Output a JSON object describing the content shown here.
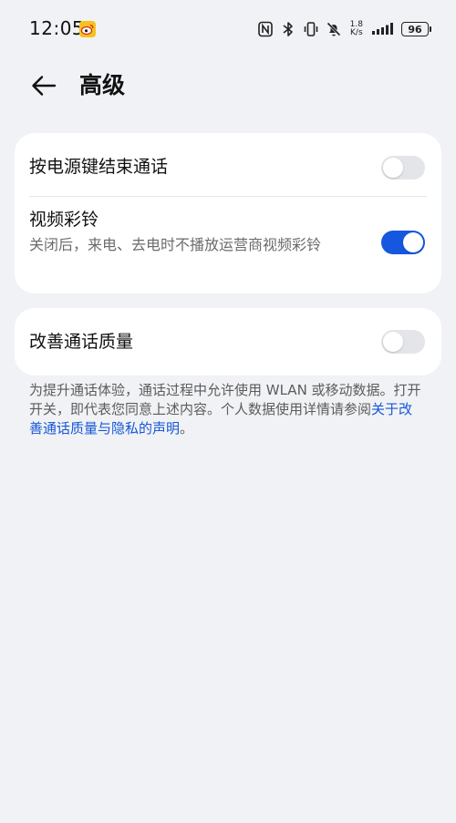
{
  "status_bar": {
    "time": "12:05",
    "speed_value": "1.8",
    "speed_unit": "K/s",
    "battery": "96",
    "icons": [
      "weibo-icon",
      "nfc-icon",
      "bluetooth-icon",
      "vibrate-icon",
      "mute-bell-icon",
      "signal-icon"
    ]
  },
  "header": {
    "title": "高级"
  },
  "settings": {
    "power_key_end_call": {
      "label": "按电源键结束通话",
      "enabled": false
    },
    "video_ringtone": {
      "label": "视频彩铃",
      "description": "关闭后，来电、去电时不播放运营商视频彩铃",
      "enabled": true
    },
    "improve_call_quality": {
      "label": "改善通话质量",
      "enabled": false
    }
  },
  "note": {
    "text": "为提升通话体验，通话过程中允许使用 WLAN 或移动数据。打开开关，即代表您同意上述内容。个人数据使用详情请参阅",
    "link": "关于改善通话质量与隐私的声明",
    "end": "。"
  },
  "colors": {
    "background": "#f1f2f5",
    "card": "#ffffff",
    "accent": "#1657e0",
    "link": "#1557d6"
  }
}
